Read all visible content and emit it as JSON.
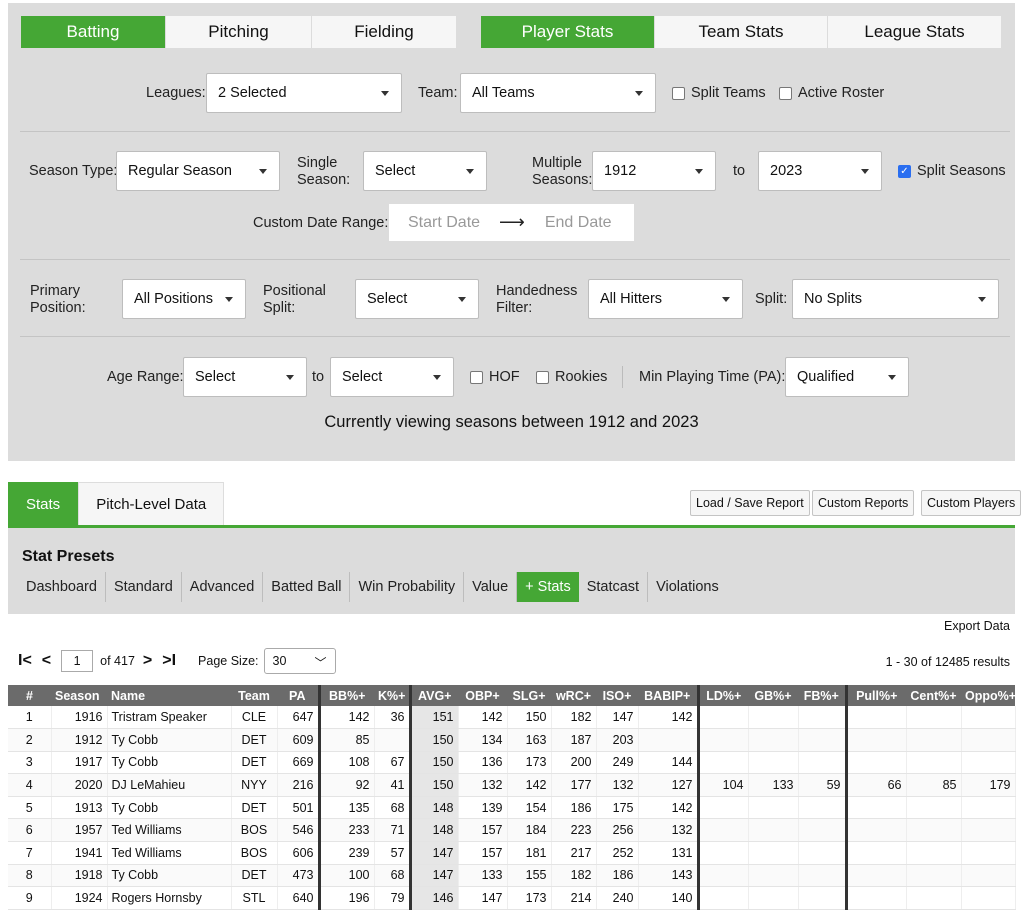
{
  "top_tabs_left": [
    "Batting",
    "Pitching",
    "Fielding"
  ],
  "top_tabs_right": [
    "Player Stats",
    "Team Stats",
    "League Stats"
  ],
  "row1": {
    "leagues_label": "Leagues:",
    "leagues_value": "2 Selected",
    "team_label": "Team:",
    "team_value": "All Teams",
    "split_teams": "Split Teams",
    "active_roster": "Active Roster"
  },
  "row2": {
    "season_type_label": "Season Type:",
    "season_type_value": "Regular Season",
    "single_label_1": "Single",
    "single_label_2": "Season:",
    "single_value": "Select",
    "multi_label_1": "Multiple",
    "multi_label_2": "Seasons:",
    "from_value": "1912",
    "to_label": "to",
    "to_value": "2023",
    "split_seasons": "Split Seasons",
    "custom_label": "Custom Date Range:",
    "start_placeholder": "Start Date",
    "arrow": "⟶",
    "end_placeholder": "End Date"
  },
  "row3": {
    "primary_1": "Primary",
    "primary_2": "Position:",
    "primary_value": "All Positions",
    "pos_split_1": "Positional",
    "pos_split_2": "Split:",
    "pos_split_value": "Select",
    "hand_1": "Handedness",
    "hand_2": "Filter:",
    "hand_value": "All Hitters",
    "split_label": "Split:",
    "split_value": "No Splits"
  },
  "row4": {
    "age_label": "Age Range:",
    "age_from": "Select",
    "to_label": "to",
    "age_to": "Select",
    "hof": "HOF",
    "rookies": "Rookies",
    "min_label": "Min Playing Time (PA):",
    "min_value": "Qualified",
    "viewing": "Currently viewing seasons between 1912 and 2023"
  },
  "lower_tabs": [
    "Stats",
    "Pitch-Level Data"
  ],
  "report_buttons": [
    "Load / Save Report",
    "Custom Reports",
    "Custom Players"
  ],
  "presets": {
    "title": "Stat Presets",
    "items": [
      "Dashboard",
      "Standard",
      "Advanced",
      "Batted Ball",
      "Win Probability",
      "Value",
      "+ Stats",
      "Statcast",
      "Violations"
    ]
  },
  "export": "Export Data",
  "pager": {
    "first": "I<",
    "prev": "<",
    "page": "1",
    "of": "of 417",
    "next": ">",
    "last": ">I",
    "size_label": "Page Size:",
    "size_value": "30",
    "results": "1 - 30 of 12485 results"
  },
  "columns": [
    "#",
    "Season",
    "Name",
    "Team",
    "PA",
    "BB%+",
    "K%+",
    "AVG+",
    "OBP+",
    "SLG+",
    "wRC+",
    "ISO+",
    "BABIP+",
    "LD%+",
    "GB%+",
    "FB%+",
    "Pull%+",
    "Cent%+",
    "Oppo%+"
  ],
  "rows": [
    [
      "1",
      "1916",
      "Tristram Speaker",
      "CLE",
      "647",
      "142",
      "36",
      "151",
      "142",
      "150",
      "182",
      "147",
      "142",
      "",
      "",
      "",
      "",
      "",
      ""
    ],
    [
      "2",
      "1912",
      "Ty Cobb",
      "DET",
      "609",
      "85",
      "",
      "150",
      "134",
      "163",
      "187",
      "203",
      "",
      "",
      "",
      "",
      "",
      "",
      ""
    ],
    [
      "3",
      "1917",
      "Ty Cobb",
      "DET",
      "669",
      "108",
      "67",
      "150",
      "136",
      "173",
      "200",
      "249",
      "144",
      "",
      "",
      "",
      "",
      "",
      ""
    ],
    [
      "4",
      "2020",
      "DJ LeMahieu",
      "NYY",
      "216",
      "92",
      "41",
      "150",
      "132",
      "142",
      "177",
      "132",
      "127",
      "104",
      "133",
      "59",
      "66",
      "85",
      "179"
    ],
    [
      "5",
      "1913",
      "Ty Cobb",
      "DET",
      "501",
      "135",
      "68",
      "148",
      "139",
      "154",
      "186",
      "175",
      "142",
      "",
      "",
      "",
      "",
      "",
      ""
    ],
    [
      "6",
      "1957",
      "Ted Williams",
      "BOS",
      "546",
      "233",
      "71",
      "148",
      "157",
      "184",
      "223",
      "256",
      "132",
      "",
      "",
      "",
      "",
      "",
      ""
    ],
    [
      "7",
      "1941",
      "Ted Williams",
      "BOS",
      "606",
      "239",
      "57",
      "147",
      "157",
      "181",
      "217",
      "252",
      "131",
      "",
      "",
      "",
      "",
      "",
      ""
    ],
    [
      "8",
      "1918",
      "Ty Cobb",
      "DET",
      "473",
      "100",
      "68",
      "147",
      "133",
      "155",
      "182",
      "186",
      "143",
      "",
      "",
      "",
      "",
      "",
      ""
    ],
    [
      "9",
      "1924",
      "Rogers Hornsby",
      "STL",
      "640",
      "196",
      "79",
      "146",
      "147",
      "173",
      "214",
      "240",
      "140",
      "",
      "",
      "",
      "",
      "",
      ""
    ]
  ],
  "colors": {
    "accent": "#45a735",
    "panel": "#dcdcdc",
    "header": "#6b6b6b"
  }
}
